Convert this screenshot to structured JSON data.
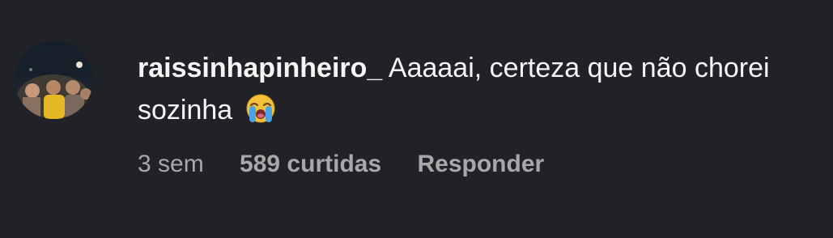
{
  "comment": {
    "username": "raissinhapinheiro_",
    "text": "Aaaaai, certeza que não chorei sozinha",
    "emoji": "loudly-crying-face",
    "time": "3 sem",
    "likes": "589 curtidas",
    "reply_label": "Responder"
  },
  "colors": {
    "background": "#212227",
    "primary_text": "#f5f5f5",
    "secondary_text": "#a8a8a8"
  }
}
